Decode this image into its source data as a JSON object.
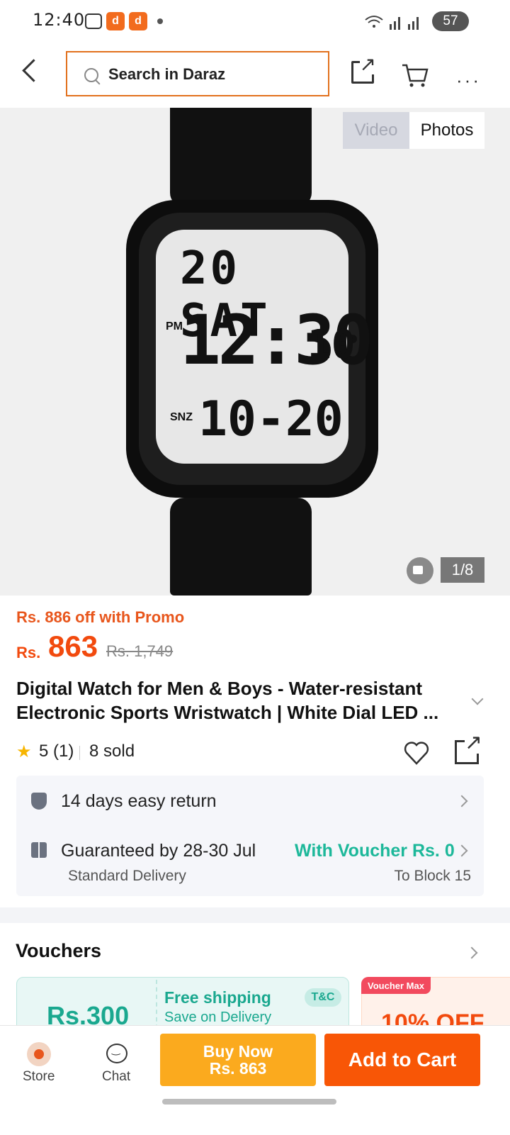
{
  "status_bar": {
    "time": "12:40",
    "battery": "57"
  },
  "search": {
    "placeholder": "Search in Daraz"
  },
  "gallery": {
    "tabs": [
      "Video",
      "Photos"
    ],
    "counter": "1/8",
    "lcd": {
      "date": "20 SAT",
      "pm": "PM",
      "time": "12:30",
      "seconds": "10",
      "snz": "SNZ",
      "bottom": "10-20"
    }
  },
  "product": {
    "promo": "Rs. 886 off with Promo",
    "currency": "Rs.",
    "price": "863",
    "old_price": "Rs. 1,749",
    "title": "Digital Watch for Men & Boys - Water-resistant Electronic Sports Wristwatch | White Dial LED ...",
    "rating": "5 (1)",
    "sold": "8 sold"
  },
  "service": {
    "return": "14 days easy return",
    "delivery": "Guaranteed by 28-30 Jul",
    "voucher": "With Voucher Rs. 0",
    "standard": "Standard Delivery",
    "destination": "To Block 15"
  },
  "vouchers": {
    "title": "Vouchers",
    "card1": {
      "amount": "Rs.300",
      "headline": "Free shipping",
      "sub": "Save on Delivery",
      "tc": "T&C"
    },
    "card2": {
      "badge": "Voucher Max",
      "amount": "10% OFF"
    }
  },
  "bottom_bar": {
    "store": "Store",
    "chat": "Chat",
    "buy_now": "Buy Now",
    "buy_price": "Rs. 863",
    "add_to_cart": "Add to Cart"
  },
  "colors": {
    "accent": "#f85606",
    "buy": "#fbaa1e",
    "teal": "#1db89a"
  }
}
